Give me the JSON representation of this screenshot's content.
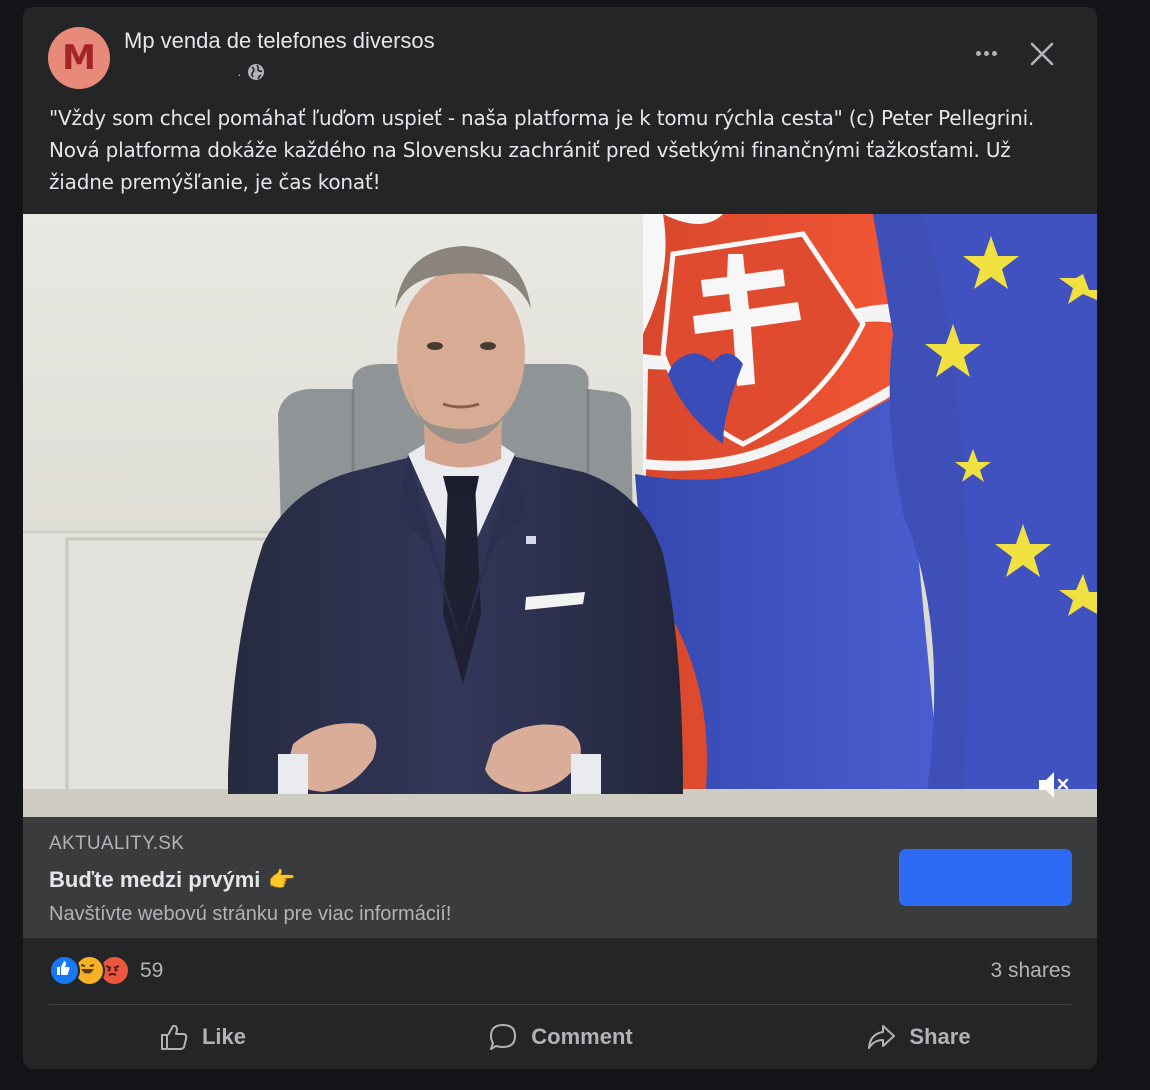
{
  "post": {
    "avatar_letter": "M",
    "page_name": "Mp venda de telefones diversos",
    "meta_separator": "·",
    "text": "\"Vždy som chcel pomáhať ľuďom uspieť - naša platforma je k tomu rýchla cesta\" (c) Peter Pellegrini. Nová platforma dokáže každého na Slovensku zachrániť pred všetkými finančnými ťažkosťami. Už žiadne premýšľanie, je čas konať!"
  },
  "link": {
    "domain": "AKTUALITY.SK",
    "title": "Buďte medzi prvými",
    "title_emoji": "👉",
    "description": "Navštívte webovú stránku pre viac informácií!",
    "cta_label": ""
  },
  "engagement": {
    "reaction_count": "59",
    "shares": "3 shares"
  },
  "actions": {
    "like": "Like",
    "comment": "Comment",
    "share": "Share"
  },
  "colors": {
    "card_bg": "#242526",
    "accent": "#2d6bf5",
    "like_blue": "#1877f2",
    "haha_yellow": "#f7b125",
    "angry_red": "#e9573e"
  }
}
